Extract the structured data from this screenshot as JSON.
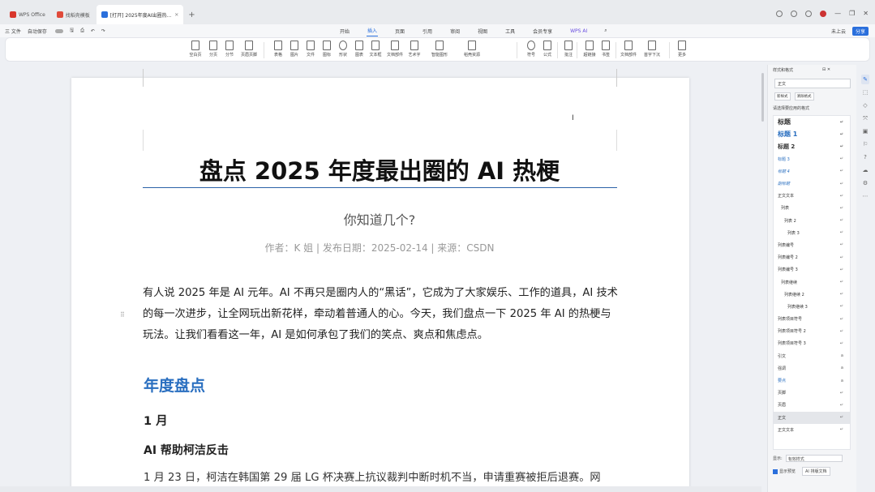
{
  "app": {
    "tabs": [
      {
        "label": "WPS Office",
        "icon_color": "#d9372c",
        "active": false
      },
      {
        "label": "找稻壳模板",
        "icon_color": "#e04a3a",
        "active": false
      },
      {
        "label": "[打开] 2025年度AI出圈热...",
        "icon_color": "#2a6fdc",
        "active": true
      }
    ],
    "new_tab": "+"
  },
  "menubar": {
    "file": "三 文件",
    "autosave": "自动保存",
    "items": [
      "开始",
      "插入",
      "页面",
      "引用",
      "审阅",
      "视图",
      "工具",
      "会员专享",
      "WPS AI"
    ],
    "active_item": "插入",
    "right": [
      "未上云",
      "分享"
    ]
  },
  "ribbon": {
    "buttons": [
      "空白页",
      "分页",
      "分节",
      "页眉页脚",
      "表格",
      "图片",
      "文件",
      "图标",
      "形状",
      "图表",
      "文本框",
      "文档部件",
      "艺术字",
      "智能图形",
      "稻壳资源",
      "符号",
      "公式",
      "批注",
      "超链接",
      "书签",
      "文档部件",
      "首字下沉",
      "更多"
    ]
  },
  "doc": {
    "title": "盘点 2025 年度最出圈的 AI 热梗",
    "subtitle": "你知道几个?",
    "meta": "作者：K 姐 | 发布日期：2025-02-14 | 来源：CSDN",
    "intro": "有人说 2025 年是 AI 元年。AI 不再只是圈内人的“黑话”，它成为了大家娱乐、工作的道具，AI 技术的每一次进步，让全网玩出新花样，牵动着普通人的心。今天，我们盘点一下 2025 年 AI 的热梗与玩法。让我们看看这一年，AI 是如何承包了我们的笑点、爽点和焦虑点。",
    "section_heading": "年度盘点",
    "month_heading": "1 月",
    "item_heading": "AI 帮助柯洁反击",
    "para1": "1 月 23 日，柯洁在韩国第 29 届 LG 杯决赛上抗议裁判中断时机不当，申请重赛被拒后退赛。网"
  },
  "style_pane": {
    "header": "样式和格式",
    "current_style": "正文",
    "btn_new": "新样式",
    "btn_clear": "清除格式",
    "label": "请选择要应用的格式",
    "styles": [
      "标题",
      "标题 1",
      "标题 2",
      "标题 3",
      "标题 4",
      "副标题",
      "正文文本",
      "列表",
      "列表 2",
      "列表 3",
      "列表编号",
      "列表编号 2",
      "列表编号 3",
      "列表继续",
      "列表继续 2",
      "列表继续 3",
      "列表项目符号",
      "列表项目符号 2",
      "列表项目符号 3",
      "引文",
      "强调",
      "要点",
      "页脚",
      "页眉",
      "正文",
      "正文文本"
    ],
    "selected_style": "正文",
    "show_label": "显示:",
    "show_value": "有效样式",
    "preview_label": "显示预览",
    "ai_label": "AI 排版文档"
  }
}
